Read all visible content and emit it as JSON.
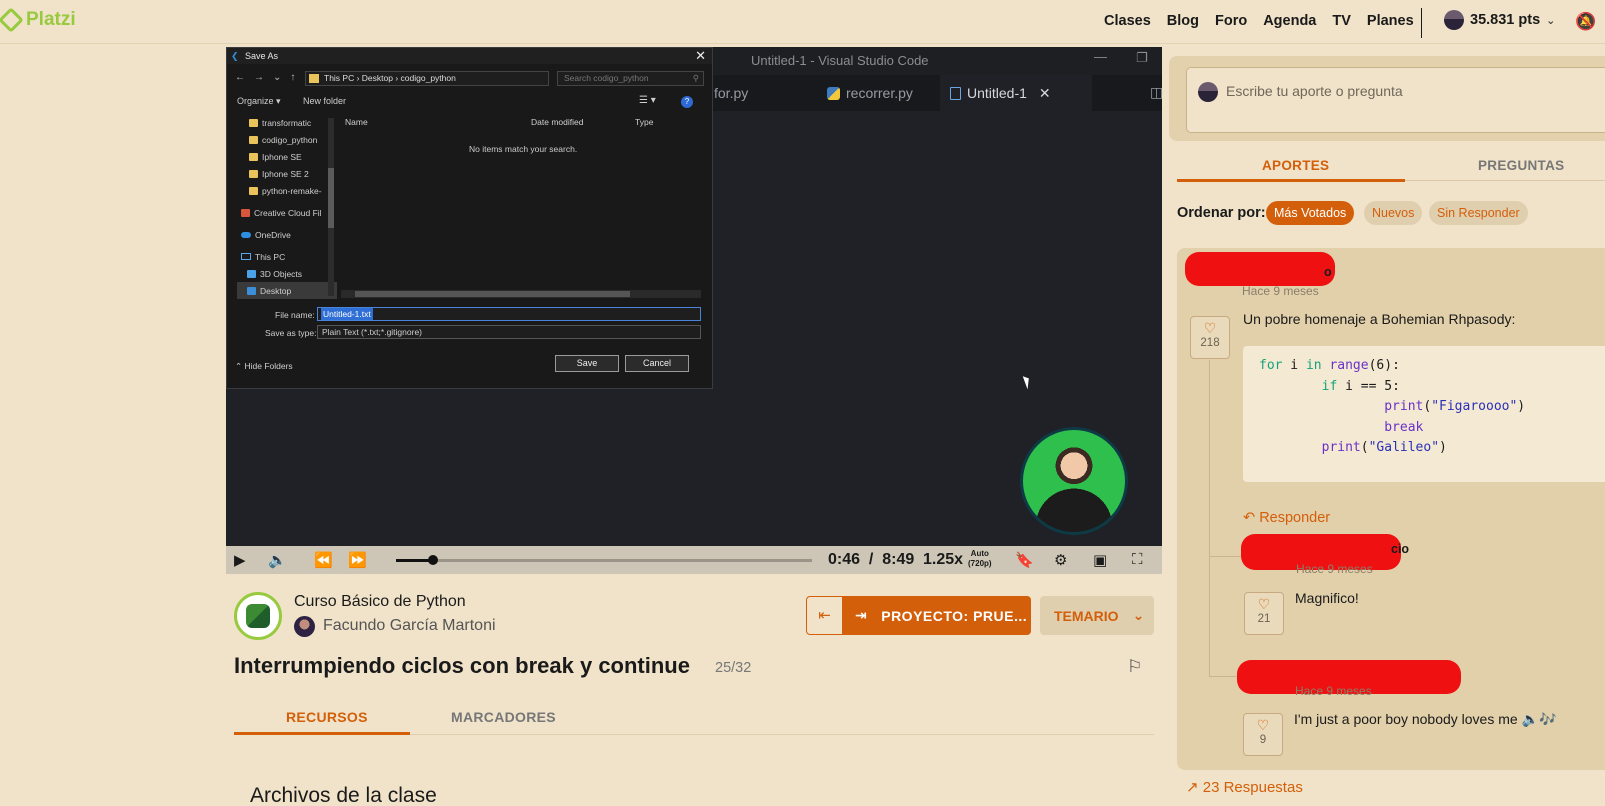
{
  "header": {
    "logo": "Platzi",
    "nav": [
      "Clases",
      "Blog",
      "Foro",
      "Agenda",
      "TV",
      "Planes"
    ],
    "points": "35.831 pts"
  },
  "video": {
    "vscode_title": "Untitled-1 - Visual Studio Code",
    "tabs": [
      "for.py",
      "recorrer.py",
      "Untitled-1"
    ],
    "dialog": {
      "title": "Save As",
      "path": [
        "This PC",
        "Desktop",
        "codigo_python"
      ],
      "search_placeholder": "Search codigo_python",
      "organize": "Organize",
      "new_folder": "New folder",
      "tree": [
        "transformatic",
        "codigo_python",
        "Iphone SE",
        "Iphone SE 2",
        "python-remake-",
        "Creative Cloud Fil",
        "OneDrive",
        "This PC",
        "3D Objects",
        "Desktop"
      ],
      "columns": [
        "Name",
        "Date modified",
        "Type"
      ],
      "empty": "No items match your search.",
      "file_name_label": "File name:",
      "file_name": "Untitled-1.txt",
      "save_type_label": "Save as type:",
      "save_type": "Plain Text (*.txt;*.gitignore)",
      "hide_folders": "Hide Folders",
      "save": "Save",
      "cancel": "Cancel"
    },
    "controls": {
      "current_time": "0:46",
      "separator": "/",
      "duration": "8:49",
      "speed": "1.25x",
      "quality_top": "Auto",
      "quality_bottom": "(720p)",
      "progress": 0.088
    }
  },
  "course": {
    "name": "Curso Básico de Python",
    "teacher": "Facundo García Martoni",
    "project_button": "PROYECTO: PRUE...",
    "syllabus_button": "TEMARIO",
    "class_title": "Interrumpiendo ciclos con break y continue",
    "class_count": "25/32",
    "tabs": [
      "RECURSOS",
      "MARCADORES"
    ],
    "files_heading": "Archivos de la clase"
  },
  "comments_panel": {
    "placeholder": "Escribe tu aporte o pregunta",
    "tabs": [
      "APORTES",
      "PREGUNTAS"
    ],
    "sort_label": "Ordenar por:",
    "sort_options": [
      "Más Votados",
      "Nuevos",
      "Sin Responder"
    ],
    "main": {
      "name_tail": "o",
      "time": "Hace 9 meses",
      "text": "Un pobre homenaje a Bohemian Rhpasody:",
      "likes": "218",
      "reply": "Responder"
    },
    "replies": [
      {
        "name_tail": "cio",
        "time": "Hace 9 meses",
        "text": "Magnifico!",
        "likes": "21"
      },
      {
        "name_tail": "",
        "time": "Hace 9 meses",
        "text": "I'm just a poor boy nobody loves me 🔈🎶",
        "likes": "9"
      }
    ],
    "replies_link": "23 Respuestas"
  },
  "colors": {
    "background": "#f0e3c9",
    "accent": "#d35f0a",
    "brand_green": "#98ca3f"
  }
}
